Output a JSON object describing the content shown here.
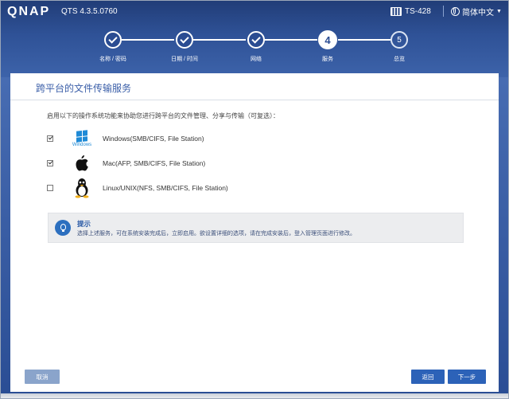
{
  "header": {
    "logo": "QNAP",
    "version": "QTS 4.3.5.0760",
    "model": "TS-428",
    "language": "简体中文"
  },
  "steps": [
    {
      "number": "✓",
      "label": "名称 / 密码",
      "state": "done"
    },
    {
      "number": "✓",
      "label": "日期 / 时间",
      "state": "done"
    },
    {
      "number": "✓",
      "label": "网络",
      "state": "done"
    },
    {
      "number": "4",
      "label": "服务",
      "state": "current"
    },
    {
      "number": "5",
      "label": "总览",
      "state": "future"
    }
  ],
  "panel": {
    "title": "跨平台的文件传输服务",
    "intro": "启用以下的操作系统功能来协助您进行跨平台的文件管理、分享与传输（可复选）："
  },
  "os_options": [
    {
      "label": "Windows(SMB/CIFS, File Station)",
      "checked": true,
      "icon": "windows-icon",
      "icon_text": "Windows"
    },
    {
      "label": "Mac(AFP, SMB/CIFS, File Station)",
      "checked": true,
      "icon": "apple-icon"
    },
    {
      "label": "Linux/UNIX(NFS, SMB/CIFS, File Station)",
      "checked": false,
      "icon": "tux-icon"
    }
  ],
  "tip": {
    "title": "提示",
    "text": "选择上述服务，可在系统安装完成后，立即启用。欲设置详细的选项，请在完成安装后，登入管理页面进行修改。",
    "icon": "lightbulb-icon"
  },
  "buttons": {
    "cancel": "取消",
    "back": "返回",
    "next": "下一步"
  },
  "colors": {
    "header_bg": "#2f5297",
    "accent": "#2c62b8",
    "title": "#3a5ea8"
  }
}
